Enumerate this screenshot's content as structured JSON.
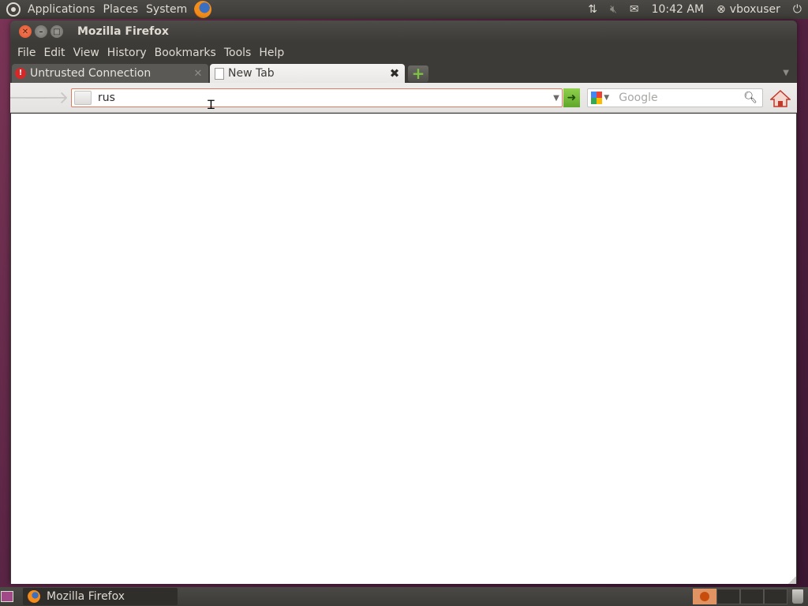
{
  "top_panel": {
    "menus": [
      "Applications",
      "Places",
      "System"
    ],
    "clock": "10:42 AM",
    "user": "vboxuser"
  },
  "window": {
    "title": "Mozilla Firefox"
  },
  "menubar": {
    "items": [
      "File",
      "Edit",
      "View",
      "History",
      "Bookmarks",
      "Tools",
      "Help"
    ]
  },
  "tabs": [
    {
      "label": "Untrusted Connection",
      "icon": "warning-icon",
      "active": false
    },
    {
      "label": "New Tab",
      "icon": "page-icon",
      "active": true
    }
  ],
  "navbar": {
    "url_value": "rus",
    "search_placeholder": "Google"
  },
  "taskbar": {
    "items": [
      "Mozilla Firefox"
    ]
  },
  "colors": {
    "panel_bg": "#3c3b37",
    "accent_orange": "#e07a5a",
    "go_green": "#5fa72a"
  }
}
